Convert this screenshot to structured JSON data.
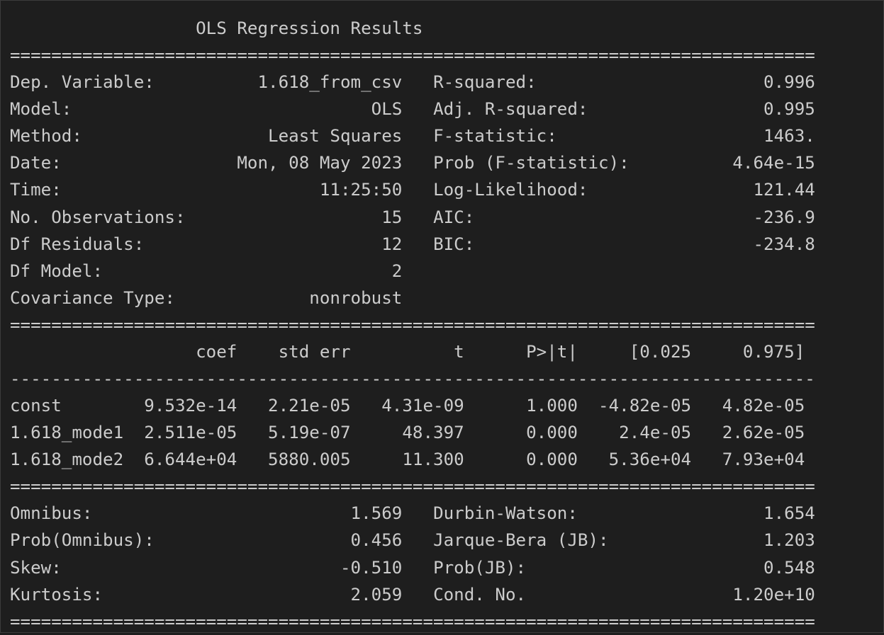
{
  "title": "OLS Regression Results",
  "separators": {
    "double_short": "==============================================================================",
    "double_long": "==============================================================================",
    "dashed": "------------------------------------------------------------------------------"
  },
  "summary_top": [
    {
      "left_label": "Dep. Variable:",
      "left_value": "1.618_from_csv",
      "right_label": "R-squared:",
      "right_value": "0.996"
    },
    {
      "left_label": "Model:",
      "left_value": "OLS",
      "right_label": "Adj. R-squared:",
      "right_value": "0.995"
    },
    {
      "left_label": "Method:",
      "left_value": "Least Squares",
      "right_label": "F-statistic:",
      "right_value": "1463."
    },
    {
      "left_label": "Date:",
      "left_value": "Mon, 08 May 2023",
      "right_label": "Prob (F-statistic):",
      "right_value": "4.64e-15"
    },
    {
      "left_label": "Time:",
      "left_value": "11:25:50",
      "right_label": "Log-Likelihood:",
      "right_value": "121.44"
    },
    {
      "left_label": "No. Observations:",
      "left_value": "15",
      "right_label": "AIC:",
      "right_value": "-236.9"
    },
    {
      "left_label": "Df Residuals:",
      "left_value": "12",
      "right_label": "BIC:",
      "right_value": "-234.8"
    },
    {
      "left_label": "Df Model:",
      "left_value": "2",
      "right_label": "",
      "right_value": ""
    },
    {
      "left_label": "Covariance Type:",
      "left_value": "nonrobust",
      "right_label": "",
      "right_value": ""
    }
  ],
  "coef_table": {
    "headers": [
      "",
      "coef",
      "std err",
      "t",
      "P>|t|",
      "[0.025",
      "0.975]"
    ],
    "rows": [
      [
        "const",
        "9.532e-14",
        "2.21e-05",
        "4.31e-09",
        "1.000",
        "-4.82e-05",
        "4.82e-05"
      ],
      [
        "1.618_mode1",
        "2.511e-05",
        "5.19e-07",
        "48.397",
        "0.000",
        "2.4e-05",
        "2.62e-05"
      ],
      [
        "1.618_mode2",
        "6.644e+04",
        "5880.005",
        "11.300",
        "0.000",
        "5.36e+04",
        "7.93e+04"
      ]
    ]
  },
  "summary_bottom": [
    {
      "left_label": "Omnibus:",
      "left_value": "1.569",
      "right_label": "Durbin-Watson:",
      "right_value": "1.654"
    },
    {
      "left_label": "Prob(Omnibus):",
      "left_value": "0.456",
      "right_label": "Jarque-Bera (JB):",
      "right_value": "1.203"
    },
    {
      "left_label": "Skew:",
      "left_value": "-0.510",
      "right_label": "Prob(JB):",
      "right_value": "0.548"
    },
    {
      "left_label": "Kurtosis:",
      "left_value": "2.059",
      "right_label": "Cond. No.",
      "right_value": "1.20e+10"
    }
  ],
  "colors": {
    "background": "#1e1e1e",
    "text": "#cccccc"
  }
}
